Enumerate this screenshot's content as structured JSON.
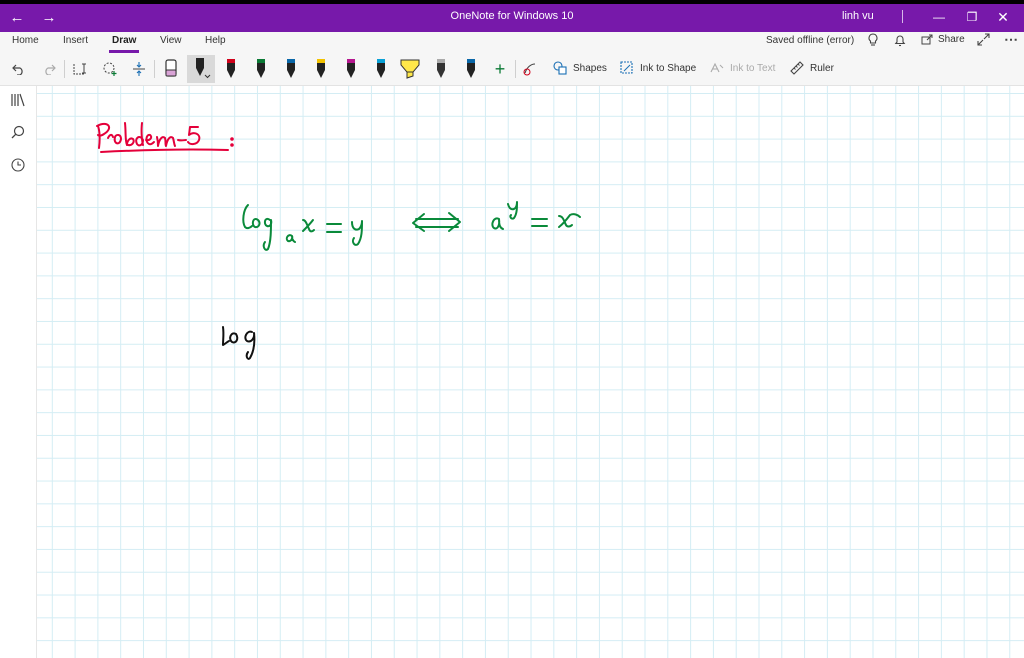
{
  "titlebar": {
    "title": "OneNote for Windows 10",
    "user": "linh vu"
  },
  "ribbon": {
    "tabs": [
      {
        "label": "Home"
      },
      {
        "label": "Insert"
      },
      {
        "label": "Draw"
      },
      {
        "label": "View"
      },
      {
        "label": "Help"
      }
    ],
    "status": "Saved offline (error)",
    "share_label": "Share",
    "tools": {
      "shapes_label": "Shapes",
      "ink_to_shape_label": "Ink to Shape",
      "ink_to_text_label": "Ink to Text",
      "ruler_label": "Ruler"
    },
    "pen_colors": [
      "#222222",
      "#222222",
      "#d0021b",
      "#0b7a35",
      "#0a67a8",
      "#f2c200",
      "#b5178e",
      "#0aa1d6",
      "#ffe84a",
      "#333333",
      "#0a67a8"
    ]
  },
  "colors": {
    "accent": "#7719aa",
    "ink_red": "#e4003a",
    "ink_green": "#0a8a3a",
    "ink_black": "#111111"
  }
}
